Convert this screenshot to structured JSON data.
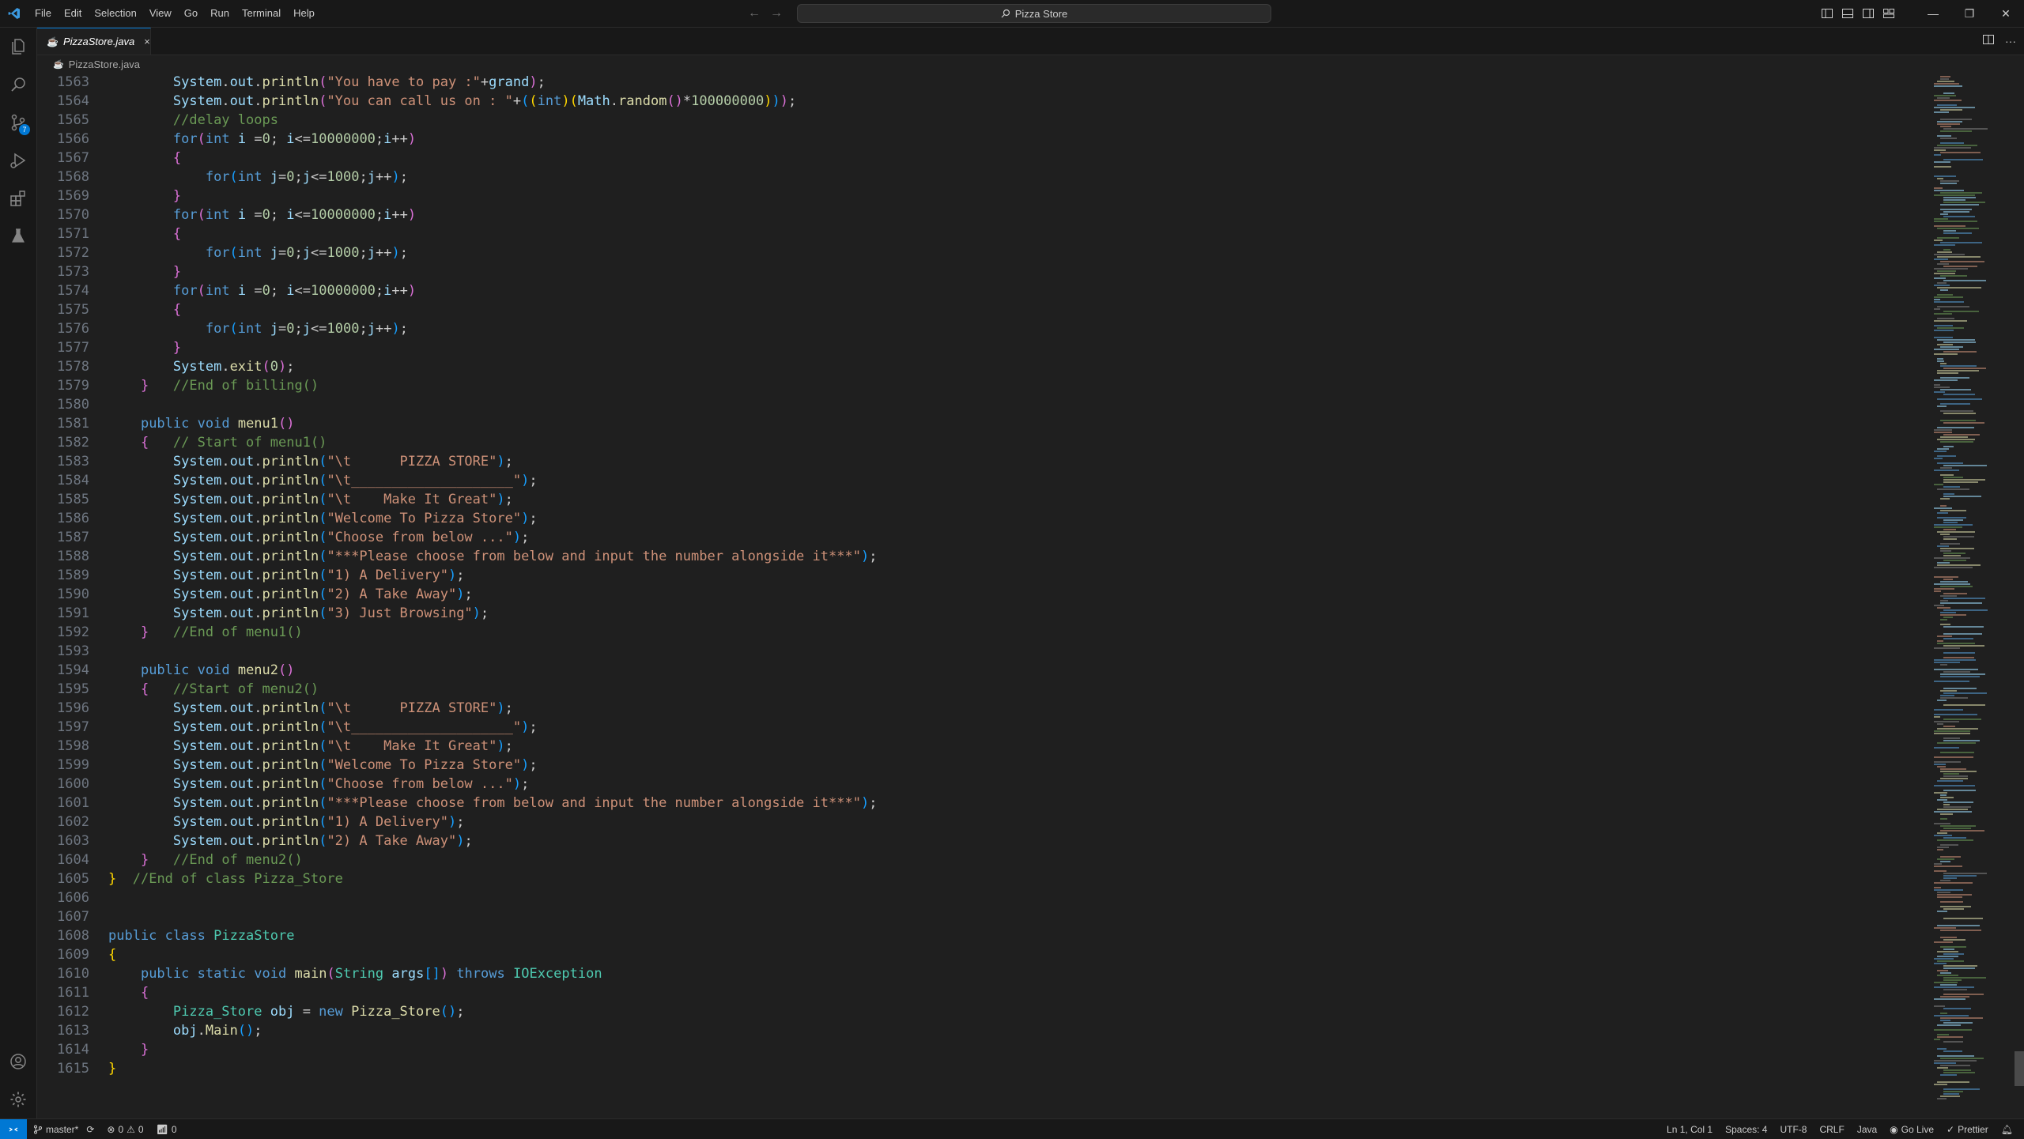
{
  "menu": [
    "File",
    "Edit",
    "Selection",
    "View",
    "Go",
    "Run",
    "Terminal",
    "Help"
  ],
  "command_center": "Pizza Store",
  "tab": {
    "label": "PizzaStore.java",
    "close": "×"
  },
  "breadcrumb": "PizzaStore.java",
  "code_lines": [
    {
      "ln": "1563",
      "html": "        <span class='v'>System</span>.<span class='v'>out</span>.<span class='f'>println</span><span class='b2'>(</span><span class='s'>\"You have to pay :\"</span>+<span class='v'>grand</span><span class='b2'>)</span>;"
    },
    {
      "ln": "1564",
      "html": "        <span class='v'>System</span>.<span class='v'>out</span>.<span class='f'>println</span><span class='b2'>(</span><span class='s'>\"You can call us on : \"</span>+<span class='b3'>(</span><span class='b1'>(</span><span class='k'>int</span><span class='b1'>)</span><span class='b1'>(</span><span class='v'>Math</span>.<span class='f'>random</span><span class='b2'>()</span>*<span class='n'>100000000</span><span class='b1'>)</span><span class='b3'>)</span><span class='b2'>)</span>;"
    },
    {
      "ln": "1565",
      "html": "        <span class='c'>//delay loops</span>"
    },
    {
      "ln": "1566",
      "html": "        <span class='k'>for</span><span class='b2'>(</span><span class='k'>int</span> <span class='v'>i</span> =<span class='n'>0</span>; <span class='v'>i</span>&lt;=<span class='n'>10000000</span>;<span class='v'>i</span>++<span class='b2'>)</span>"
    },
    {
      "ln": "1567",
      "html": "        <span class='b2'>{</span>"
    },
    {
      "ln": "1568",
      "html": "            <span class='k'>for</span><span class='b3'>(</span><span class='k'>int</span> <span class='v'>j</span>=<span class='n'>0</span>;<span class='v'>j</span>&lt;=<span class='n'>1000</span>;<span class='v'>j</span>++<span class='b3'>)</span>;"
    },
    {
      "ln": "1569",
      "html": "        <span class='b2'>}</span>"
    },
    {
      "ln": "1570",
      "html": "        <span class='k'>for</span><span class='b2'>(</span><span class='k'>int</span> <span class='v'>i</span> =<span class='n'>0</span>; <span class='v'>i</span>&lt;=<span class='n'>10000000</span>;<span class='v'>i</span>++<span class='b2'>)</span>"
    },
    {
      "ln": "1571",
      "html": "        <span class='b2'>{</span>"
    },
    {
      "ln": "1572",
      "html": "            <span class='k'>for</span><span class='b3'>(</span><span class='k'>int</span> <span class='v'>j</span>=<span class='n'>0</span>;<span class='v'>j</span>&lt;=<span class='n'>1000</span>;<span class='v'>j</span>++<span class='b3'>)</span>;"
    },
    {
      "ln": "1573",
      "html": "        <span class='b2'>}</span>"
    },
    {
      "ln": "1574",
      "html": "        <span class='k'>for</span><span class='b2'>(</span><span class='k'>int</span> <span class='v'>i</span> =<span class='n'>0</span>; <span class='v'>i</span>&lt;=<span class='n'>10000000</span>;<span class='v'>i</span>++<span class='b2'>)</span>"
    },
    {
      "ln": "1575",
      "html": "        <span class='b2'>{</span>"
    },
    {
      "ln": "1576",
      "html": "            <span class='k'>for</span><span class='b3'>(</span><span class='k'>int</span> <span class='v'>j</span>=<span class='n'>0</span>;<span class='v'>j</span>&lt;=<span class='n'>1000</span>;<span class='v'>j</span>++<span class='b3'>)</span>;"
    },
    {
      "ln": "1577",
      "html": "        <span class='b2'>}</span>"
    },
    {
      "ln": "1578",
      "html": "        <span class='v'>System</span>.<span class='f'>exit</span><span class='b2'>(</span><span class='n'>0</span><span class='b2'>)</span>;"
    },
    {
      "ln": "1579",
      "html": "    <span class='b2'>}</span>   <span class='c'>//End of billing()</span>"
    },
    {
      "ln": "1580",
      "html": ""
    },
    {
      "ln": "1581",
      "html": "    <span class='k'>public</span> <span class='k'>void</span> <span class='f'>menu1</span><span class='b2'>()</span>"
    },
    {
      "ln": "1582",
      "html": "    <span class='b2'>{</span>   <span class='c'>// Start of menu1()</span>"
    },
    {
      "ln": "1583",
      "html": "        <span class='v'>System</span>.<span class='v'>out</span>.<span class='f'>println</span><span class='b3'>(</span><span class='s'>\"\\t      PIZZA STORE\"</span><span class='b3'>)</span>;"
    },
    {
      "ln": "1584",
      "html": "        <span class='v'>System</span>.<span class='v'>out</span>.<span class='f'>println</span><span class='b3'>(</span><span class='s'>\"\\t____________________\"</span><span class='b3'>)</span>;"
    },
    {
      "ln": "1585",
      "html": "        <span class='v'>System</span>.<span class='v'>out</span>.<span class='f'>println</span><span class='b3'>(</span><span class='s'>\"\\t    Make It Great\"</span><span class='b3'>)</span>;"
    },
    {
      "ln": "1586",
      "html": "        <span class='v'>System</span>.<span class='v'>out</span>.<span class='f'>println</span><span class='b3'>(</span><span class='s'>\"Welcome To Pizza Store\"</span><span class='b3'>)</span>;"
    },
    {
      "ln": "1587",
      "html": "        <span class='v'>System</span>.<span class='v'>out</span>.<span class='f'>println</span><span class='b3'>(</span><span class='s'>\"Choose from below ...\"</span><span class='b3'>)</span>;"
    },
    {
      "ln": "1588",
      "html": "        <span class='v'>System</span>.<span class='v'>out</span>.<span class='f'>println</span><span class='b3'>(</span><span class='s'>\"***Please choose from below and input the number alongside it***\"</span><span class='b3'>)</span>;"
    },
    {
      "ln": "1589",
      "html": "        <span class='v'>System</span>.<span class='v'>out</span>.<span class='f'>println</span><span class='b3'>(</span><span class='s'>\"1) A Delivery\"</span><span class='b3'>)</span>;"
    },
    {
      "ln": "1590",
      "html": "        <span class='v'>System</span>.<span class='v'>out</span>.<span class='f'>println</span><span class='b3'>(</span><span class='s'>\"2) A Take Away\"</span><span class='b3'>)</span>;"
    },
    {
      "ln": "1591",
      "html": "        <span class='v'>System</span>.<span class='v'>out</span>.<span class='f'>println</span><span class='b3'>(</span><span class='s'>\"3) Just Browsing\"</span><span class='b3'>)</span>;"
    },
    {
      "ln": "1592",
      "html": "    <span class='b2'>}</span>   <span class='c'>//End of menu1()</span>"
    },
    {
      "ln": "1593",
      "html": ""
    },
    {
      "ln": "1594",
      "html": "    <span class='k'>public</span> <span class='k'>void</span> <span class='f'>menu2</span><span class='b2'>()</span>"
    },
    {
      "ln": "1595",
      "html": "    <span class='b2'>{</span>   <span class='c'>//Start of menu2()</span>"
    },
    {
      "ln": "1596",
      "html": "        <span class='v'>System</span>.<span class='v'>out</span>.<span class='f'>println</span><span class='b3'>(</span><span class='s'>\"\\t      PIZZA STORE\"</span><span class='b3'>)</span>;"
    },
    {
      "ln": "1597",
      "html": "        <span class='v'>System</span>.<span class='v'>out</span>.<span class='f'>println</span><span class='b3'>(</span><span class='s'>\"\\t____________________\"</span><span class='b3'>)</span>;"
    },
    {
      "ln": "1598",
      "html": "        <span class='v'>System</span>.<span class='v'>out</span>.<span class='f'>println</span><span class='b3'>(</span><span class='s'>\"\\t    Make It Great\"</span><span class='b3'>)</span>;"
    },
    {
      "ln": "1599",
      "html": "        <span class='v'>System</span>.<span class='v'>out</span>.<span class='f'>println</span><span class='b3'>(</span><span class='s'>\"Welcome To Pizza Store\"</span><span class='b3'>)</span>;"
    },
    {
      "ln": "1600",
      "html": "        <span class='v'>System</span>.<span class='v'>out</span>.<span class='f'>println</span><span class='b3'>(</span><span class='s'>\"Choose from below ...\"</span><span class='b3'>)</span>;"
    },
    {
      "ln": "1601",
      "html": "        <span class='v'>System</span>.<span class='v'>out</span>.<span class='f'>println</span><span class='b3'>(</span><span class='s'>\"***Please choose from below and input the number alongside it***\"</span><span class='b3'>)</span>;"
    },
    {
      "ln": "1602",
      "html": "        <span class='v'>System</span>.<span class='v'>out</span>.<span class='f'>println</span><span class='b3'>(</span><span class='s'>\"1) A Delivery\"</span><span class='b3'>)</span>;"
    },
    {
      "ln": "1603",
      "html": "        <span class='v'>System</span>.<span class='v'>out</span>.<span class='f'>println</span><span class='b3'>(</span><span class='s'>\"2) A Take Away\"</span><span class='b3'>)</span>;"
    },
    {
      "ln": "1604",
      "html": "    <span class='b2'>}</span>   <span class='c'>//End of menu2()</span>"
    },
    {
      "ln": "1605",
      "html": "<span class='b1'>}</span>  <span class='c'>//End of class Pizza_Store</span>"
    },
    {
      "ln": "1606",
      "html": ""
    },
    {
      "ln": "1607",
      "html": ""
    },
    {
      "ln": "1608",
      "html": "<span class='k'>public</span> <span class='k'>class</span> <span class='t'>PizzaStore</span>"
    },
    {
      "ln": "1609",
      "html": "<span class='b1'>{</span>"
    },
    {
      "ln": "1610",
      "html": "    <span class='k'>public</span> <span class='k'>static</span> <span class='k'>void</span> <span class='f'>main</span><span class='b2'>(</span><span class='t'>String</span> <span class='v'>args</span><span class='b3'>[]</span><span class='b2'>)</span> <span class='k'>throws</span> <span class='t'>IOException</span>"
    },
    {
      "ln": "1611",
      "html": "    <span class='b2'>{</span>"
    },
    {
      "ln": "1612",
      "html": "        <span class='t'>Pizza_Store</span> <span class='v'>obj</span> = <span class='k'>new</span> <span class='f'>Pizza_Store</span><span class='b3'>()</span>;"
    },
    {
      "ln": "1613",
      "html": "        <span class='v'>obj</span>.<span class='f'>Main</span><span class='b3'>()</span>;"
    },
    {
      "ln": "1614",
      "html": "    <span class='b2'>}</span>"
    },
    {
      "ln": "1615",
      "html": "<span class='b1'>}</span>"
    }
  ],
  "status": {
    "branch": "master*",
    "errors": "0",
    "warnings": "0",
    "ports": "0",
    "position": "Ln 1, Col 1",
    "spaces": "Spaces: 4",
    "encoding": "UTF-8",
    "eol": "CRLF",
    "language": "Java",
    "golive": "Go Live",
    "prettier": "Prettier"
  },
  "scm_badge": "7",
  "colors": {
    "accent": "#0078d4",
    "background": "#1f1f1f",
    "chrome": "#181818"
  }
}
